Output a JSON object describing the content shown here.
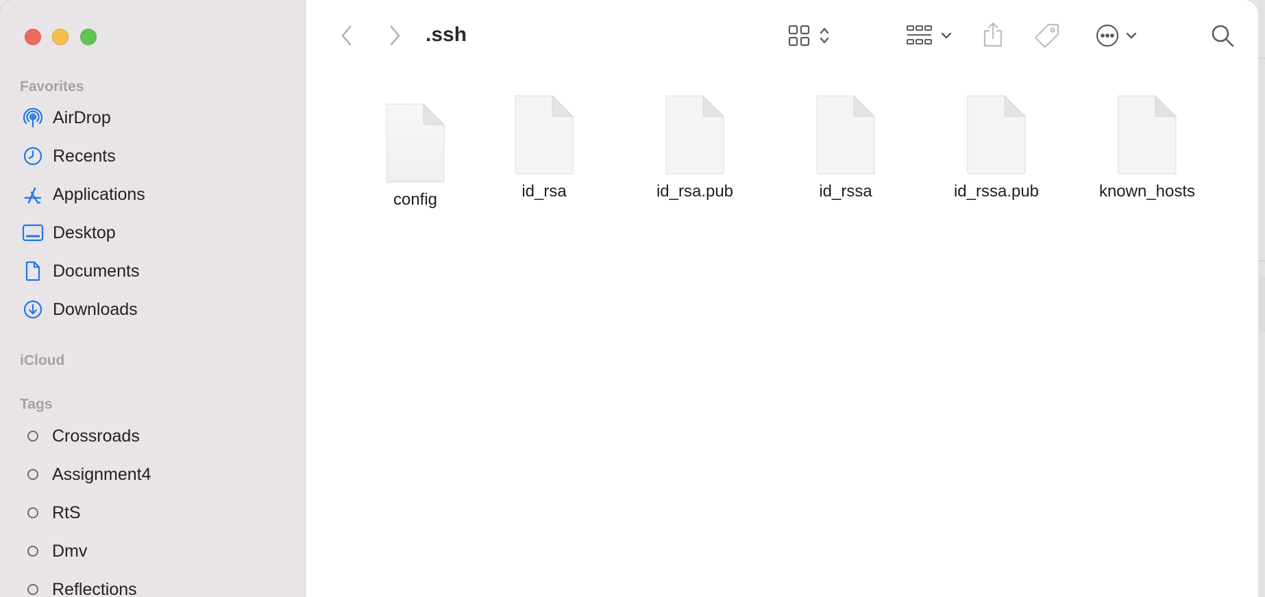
{
  "window": {
    "title": ".ssh"
  },
  "sidebar": {
    "favorites_header": "Favorites",
    "favorites": [
      {
        "label": "AirDrop",
        "icon": "airdrop-icon"
      },
      {
        "label": "Recents",
        "icon": "clock-icon"
      },
      {
        "label": "Applications",
        "icon": "applications-icon"
      },
      {
        "label": "Desktop",
        "icon": "desktop-icon"
      },
      {
        "label": "Documents",
        "icon": "document-icon"
      },
      {
        "label": "Downloads",
        "icon": "download-icon"
      }
    ],
    "icloud_header": "iCloud",
    "tags_header": "Tags",
    "tags": [
      {
        "label": "Crossroads"
      },
      {
        "label": "Assignment4"
      },
      {
        "label": "RtS"
      },
      {
        "label": "Dmv"
      },
      {
        "label": "Reflections"
      }
    ]
  },
  "toolbar": {
    "back": "chevron-left-icon",
    "forward": "chevron-right-icon",
    "view_mode": "grid-view-icon",
    "group": "group-icon",
    "share": "share-icon",
    "tag": "tag-icon",
    "more": "ellipsis-icon",
    "search": "search-icon"
  },
  "files": [
    {
      "name": "config"
    },
    {
      "name": "id_rsa"
    },
    {
      "name": "id_rsa.pub"
    },
    {
      "name": "id_rssa"
    },
    {
      "name": "id_rssa.pub"
    },
    {
      "name": "known_hosts"
    }
  ],
  "colors": {
    "accent": "#1e78e6",
    "sidebar_bg": "#e8e4e8"
  }
}
